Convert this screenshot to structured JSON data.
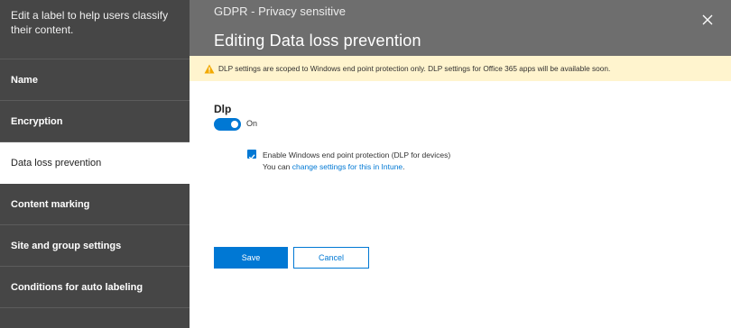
{
  "sidebar": {
    "intro": "Edit a label to help users classify their content.",
    "items": [
      {
        "label": "Name",
        "active": false
      },
      {
        "label": "Encryption",
        "active": false
      },
      {
        "label": "Data loss prevention",
        "active": true
      },
      {
        "label": "Content marking",
        "active": false
      },
      {
        "label": "Site and group settings",
        "active": false
      },
      {
        "label": "Conditions for auto labeling",
        "active": false
      }
    ]
  },
  "header": {
    "label_name": "GDPR - Privacy sensitive",
    "title": "Editing Data loss prevention",
    "close_icon": "close-icon"
  },
  "banner": {
    "icon": "warning-icon",
    "text": "DLP settings are scoped to Windows end point protection only. DLP settings for Office 365 apps will be available soon."
  },
  "main": {
    "dlp_label": "Dlp",
    "toggle": {
      "state": true,
      "text": "On"
    },
    "checkbox": {
      "checked": true,
      "label": "Enable Windows end point protection (DLP for devices)",
      "help_prefix": "You can ",
      "help_link": "change settings for this in Intune",
      "help_suffix": "."
    },
    "buttons": {
      "save": "Save",
      "cancel": "Cancel"
    }
  },
  "colors": {
    "sidebar_bg": "#464646",
    "header_bg": "#6e6e6e",
    "banner_bg": "#fff4ce",
    "accent": "#0078d4",
    "warning": "#f2a900"
  }
}
